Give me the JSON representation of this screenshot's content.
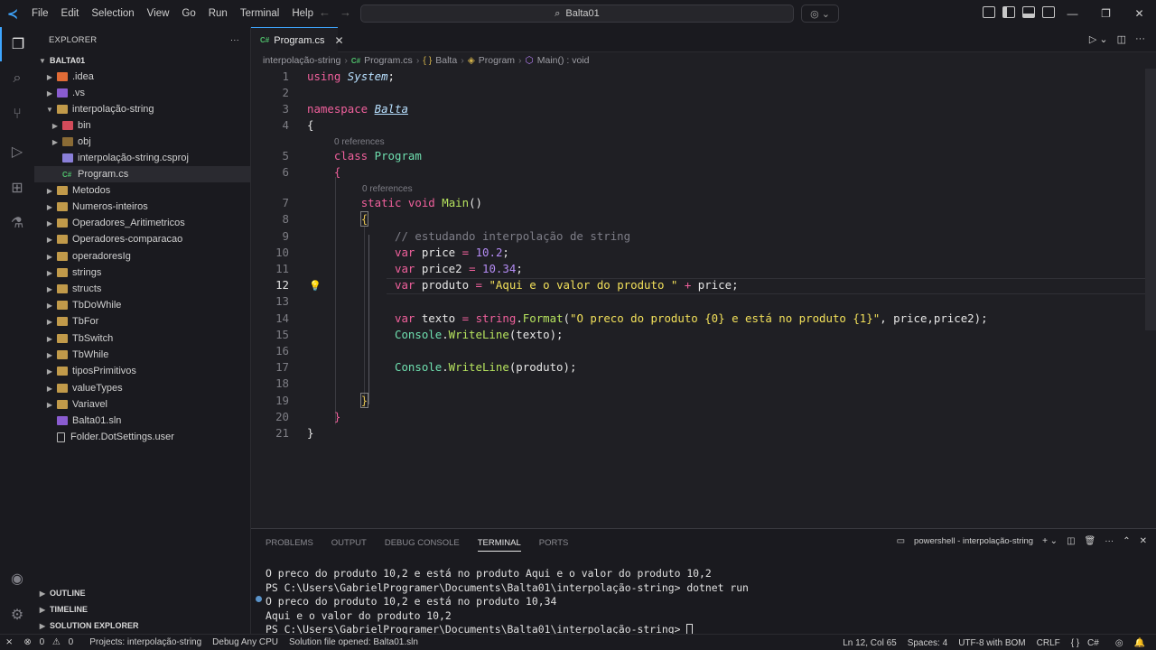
{
  "titlebar": {
    "menu": [
      "File",
      "Edit",
      "Selection",
      "View",
      "Go",
      "Run",
      "Terminal",
      "Help"
    ],
    "search_text": "Balta01"
  },
  "explorer": {
    "header": "EXPLORER",
    "root": "BALTA01",
    "items": [
      ".idea",
      ".vs",
      "interpolação-string",
      "bin",
      "obj",
      "interpolação-string.csproj",
      "Program.cs",
      "Metodos",
      "Numeros-inteiros",
      "Operadores_Aritimetricos",
      "Operadores-comparacao",
      "operadoresIg",
      "strings",
      "structs",
      "TbDoWhile",
      "TbFor",
      "TbSwitch",
      "TbWhile",
      "tiposPrimitivos",
      "valueTypes",
      "Variavel",
      "Balta01.sln",
      "Folder.DotSettings.user"
    ],
    "bottom_sections": [
      "OUTLINE",
      "TIMELINE",
      "SOLUTION EXPLORER"
    ]
  },
  "editor": {
    "tab_label": "Program.cs",
    "breadcrumb": [
      "interpolação-string",
      "Program.cs",
      "Balta",
      "Program",
      "Main() : void"
    ],
    "codelens": "0 references",
    "line_numbers": [
      "1",
      "2",
      "3",
      "4",
      "5",
      "6",
      "7",
      "8",
      "9",
      "10",
      "11",
      "12",
      "13",
      "14",
      "15",
      "16",
      "17",
      "18",
      "19",
      "20",
      "21"
    ],
    "current_line": "12"
  },
  "code": {
    "l1_kw": "using",
    "l1_ns": "System",
    "l3_kw": "namespace",
    "l3_ns": "Balta",
    "l5_kw": "class",
    "l5_ty": "Program",
    "l7_kw1": "static",
    "l7_kw2": "void",
    "l7_fn": "Main",
    "l9_comment": "// estudando interpolação de string",
    "l10_var": "price",
    "l10_num": "10.2",
    "l11_var": "price2",
    "l11_num": "10.34",
    "l12_var": "produto",
    "l12_str": "\"Aqui e o valor do produto \"",
    "l12_ref": "price",
    "l14_var": "texto",
    "l14_ty": "string",
    "l14_fn": "Format",
    "l14_str": "\"O preco do produto {0} e está no produto {1}\"",
    "l14_args": "price,price2",
    "l15_ty": "Console",
    "l15_fn": "WriteLine",
    "l15_arg": "texto",
    "l17_ty": "Console",
    "l17_fn": "WriteLine",
    "l17_arg": "produto",
    "kw_var": "var"
  },
  "panel": {
    "tabs": [
      "PROBLEMS",
      "OUTPUT",
      "DEBUG CONSOLE",
      "TERMINAL",
      "PORTS"
    ],
    "active_tab": "TERMINAL",
    "terminal_name": "powershell - interpolação-string",
    "lines": [
      "O preco do produto 10,2 e está no produto Aqui e o valor do produto 10,2",
      "PS C:\\Users\\GabrielProgramer\\Documents\\Balta01\\interpolação-string> dotnet run",
      "O preco do produto 10,2 e está no produto 10,34",
      "Aqui e o valor do produto 10,2",
      "PS C:\\Users\\GabrielProgramer\\Documents\\Balta01\\interpolação-string> "
    ]
  },
  "statusbar": {
    "problems": "0",
    "warnings": "0",
    "project": "Projects: interpolação-string",
    "debug": "Debug Any CPU",
    "solution": "Solution file opened: Balta01.sln",
    "position": "Ln 12, Col 65",
    "spaces": "Spaces: 4",
    "encoding": "UTF-8 with BOM",
    "eol": "CRLF",
    "language": "C#"
  }
}
